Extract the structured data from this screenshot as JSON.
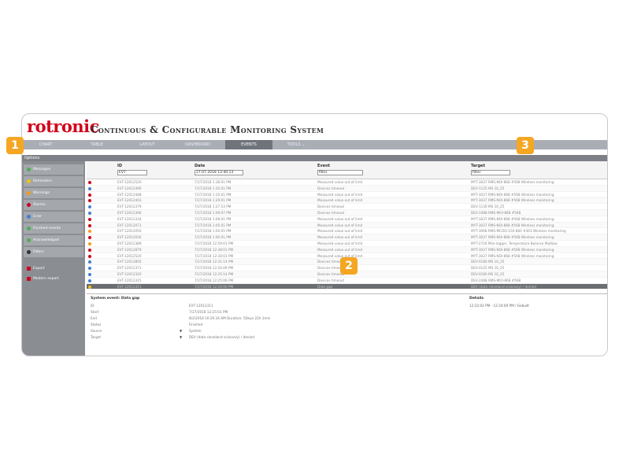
{
  "app": {
    "logo": "rotronic",
    "title": "Continuous & Configurable Monitoring System"
  },
  "colors": {
    "brand": "#d0021b",
    "badge": "#f5a623",
    "nav_bg": "#a9adb4",
    "nav_active": "#6f737a",
    "sidebar_bg": "#8a8d92"
  },
  "nav": {
    "items": [
      {
        "label": "Chart",
        "active": false
      },
      {
        "label": "Table",
        "active": false
      },
      {
        "label": "Layout",
        "active": false
      },
      {
        "label": "Dashboard",
        "active": false
      },
      {
        "label": "Events",
        "active": true
      },
      {
        "label": "Tools ⌄",
        "active": false
      }
    ]
  },
  "sidebar": {
    "options_label": "Options",
    "filters": [
      {
        "label": "Messages",
        "color": "#4caf50"
      },
      {
        "label": "Reminders",
        "color": "#f1c40f"
      },
      {
        "label": "Warnings",
        "color": "#f39c12"
      },
      {
        "label": "Alarms",
        "color": "#d0021b"
      },
      {
        "label": "Error",
        "color": "#3f7fd0"
      },
      {
        "label": "Finished events",
        "color": "#4caf50"
      },
      {
        "label": "Acknowledged",
        "color": "#4caf50"
      },
      {
        "label": "Filters",
        "color": "#333333"
      }
    ],
    "links": [
      {
        "label": "Export"
      },
      {
        "label": "Modern export"
      }
    ]
  },
  "table": {
    "columns": [
      {
        "label": "ID",
        "filter": "EVT"
      },
      {
        "label": "Date",
        "filter": "27.07.2018 13:40:13"
      },
      {
        "label": "Event",
        "filter": "filter"
      },
      {
        "label": "Target",
        "filter": "filter"
      }
    ],
    "rows": [
      {
        "status": "#d0021b",
        "id": "EVT-12012520",
        "date": "7/27/2018 1:38:01 PM",
        "event": "Measured value out of limit",
        "target": "MYT-3037 RMS-NOI-868 #568 Wireless monitoring"
      },
      {
        "status": "#3f7fd0",
        "id": "EVT-12012490",
        "date": "7/27/2018 1:35:01 PM",
        "event": "Devices timeout",
        "target": "DEV-1125 MS 10_25"
      },
      {
        "status": "#d0021b",
        "id": "EVT-12012488",
        "date": "7/27/2018 1:35:01 PM",
        "event": "Measured value out of limit",
        "target": "MYT-3037 RMS-NOI-868 #568 Wireless monitoring"
      },
      {
        "status": "#d0021b",
        "id": "EVT-12012403",
        "date": "7/27/2018 1:29:01 PM",
        "event": "Measured value out of limit",
        "target": "MYT-3037 RMS-NOI-868 #568 Wireless monitoring"
      },
      {
        "status": "#3f7fd0",
        "id": "EVT-12012379",
        "date": "7/27/2018 1:27:53 PM",
        "event": "Devices timeout",
        "target": "DEV-1130 MS 10_25"
      },
      {
        "status": "#3f7fd0",
        "id": "EVT-12012366",
        "date": "7/27/2018 1:09:07 PM",
        "event": "Devices timeout",
        "target": "DEV-2488 RMS-MOI-868 #568"
      },
      {
        "status": "#d0021b",
        "id": "EVT-12012334",
        "date": "7/27/2018 1:08:01 PM",
        "event": "Measured value out of limit",
        "target": "MYT-3037 RMS-NOI-868 #568 Wireless monitoring"
      },
      {
        "status": "#d0021b",
        "id": "EVT-12012071",
        "date": "7/27/2018 1:05:01 PM",
        "event": "Measured value out of limit",
        "target": "MYT-3037 RMS-NOI-868 #568 Wireless monitoring"
      },
      {
        "status": "#f39c12",
        "id": "EVT-12012050",
        "date": "7/27/2018 1:00:05 PM",
        "event": "Measured value out of limit",
        "target": "MYT-3068 RMS-MCOO-150-860 #363 Wireless monitoring"
      },
      {
        "status": "#d0021b",
        "id": "EVT-12012030",
        "date": "7/27/2018 1:00:01 PM",
        "event": "Measured value out of limit",
        "target": "MYT-3037 RMS-NOI-868 #568 Wireless monitoring"
      },
      {
        "status": "#f39c12",
        "id": "EVT-12012389",
        "date": "7/27/2018 12:59:01 PM",
        "event": "Measured value out of limit",
        "target": "MYT-2726 Mini-logger, Temperature Balance Mailbox"
      },
      {
        "status": "#d0021b",
        "id": "EVT-12012879",
        "date": "7/27/2018 12:38:01 PM",
        "event": "Measured value out of limit",
        "target": "MYT-3037 RMS-NOI-868 #568 Wireless monitoring"
      },
      {
        "status": "#d0021b",
        "id": "EVT-12012520",
        "date": "7/27/2018 12:30:01 PM",
        "event": "Measured value out of limit",
        "target": "MYT-3037 RMS-NOI-868 #568 Wireless monitoring"
      },
      {
        "status": "#3f7fd0",
        "id": "EVT-12012805",
        "date": "7/27/2018 12:31:14 PM",
        "event": "Devices timeout",
        "target": "DEV-0180 MS 10_25"
      },
      {
        "status": "#3f7fd0",
        "id": "EVT-12012371",
        "date": "7/27/2018 12:20:09 PM",
        "event": "Devices timeout",
        "target": "DEV-0125 MS 10_25"
      },
      {
        "status": "#3f7fd0",
        "id": "EVT-12012320",
        "date": "7/27/2018 12:25:14 PM",
        "event": "Devices timeout",
        "target": "DEV-0180 MS 10_25"
      },
      {
        "status": "#3f7fd0",
        "id": "EVT-12012315",
        "date": "7/27/2018 12:25:06 PM",
        "event": "Devices timeout",
        "target": "DEV-2488 RMS-MOI-868 #568"
      },
      {
        "status": "#f1c40f",
        "id": "EVT-12012311",
        "date": "7/27/2018 12:24:00 PM",
        "event": "Data gap",
        "target": "DEV (data cleveland visionary) / denied",
        "selected": true
      }
    ]
  },
  "details": {
    "title": "System event: Data gap",
    "details_label": "Details",
    "details_value": "12:22:02 PM - 12:24:00 PM / Gebuilt",
    "fields": [
      {
        "label": "ID",
        "value": "EVT-12012311",
        "filter": false
      },
      {
        "label": "Start",
        "value": "7/27/2018 12:25:01 PM",
        "filter": false
      },
      {
        "label": "End",
        "value": "8/2/2018 10:26:16 AM Duration: 5Days 22h 1min",
        "filter": false
      },
      {
        "label": "Status",
        "value": "Finished",
        "filter": false
      },
      {
        "label": "Source",
        "value": "System",
        "filter": true
      },
      {
        "label": "Target",
        "value": "DEV (data cleveland visionary) / denied",
        "filter": true
      }
    ],
    "filter_glyph": "▼"
  },
  "badges": [
    "1",
    "2",
    "3"
  ]
}
